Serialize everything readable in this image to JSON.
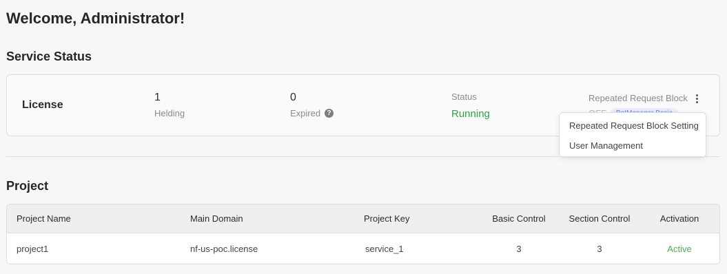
{
  "page": {
    "title": "Welcome, Administrator!"
  },
  "service_status": {
    "title": "Service Status",
    "license_label": "License",
    "holding": {
      "value": "1",
      "label": "Helding"
    },
    "expired": {
      "value": "0",
      "label": "Expired",
      "help_icon": "question-circle-icon"
    },
    "status": {
      "label": "Status",
      "value": "Running",
      "color": "#2da24a"
    },
    "repeated_request_block": {
      "label": "Repeated Request Block",
      "state": "OFF",
      "badge": "BotManager Basic"
    },
    "menu": {
      "items": [
        "Repeated Request Block Setting",
        "User Management"
      ]
    }
  },
  "project": {
    "title": "Project",
    "columns": [
      "Project Name",
      "Main Domain",
      "Project Key",
      "Basic Control",
      "Section Control",
      "Activation"
    ],
    "rows": [
      {
        "name": "project1",
        "domain": "nf-us-poc.license",
        "key": "service_1",
        "basic_control": "3",
        "section_control": "3",
        "activation": "Active"
      }
    ]
  },
  "colors": {
    "running": "#2da24a",
    "active": "#4caf50",
    "badge_text": "#6b7fe0"
  }
}
